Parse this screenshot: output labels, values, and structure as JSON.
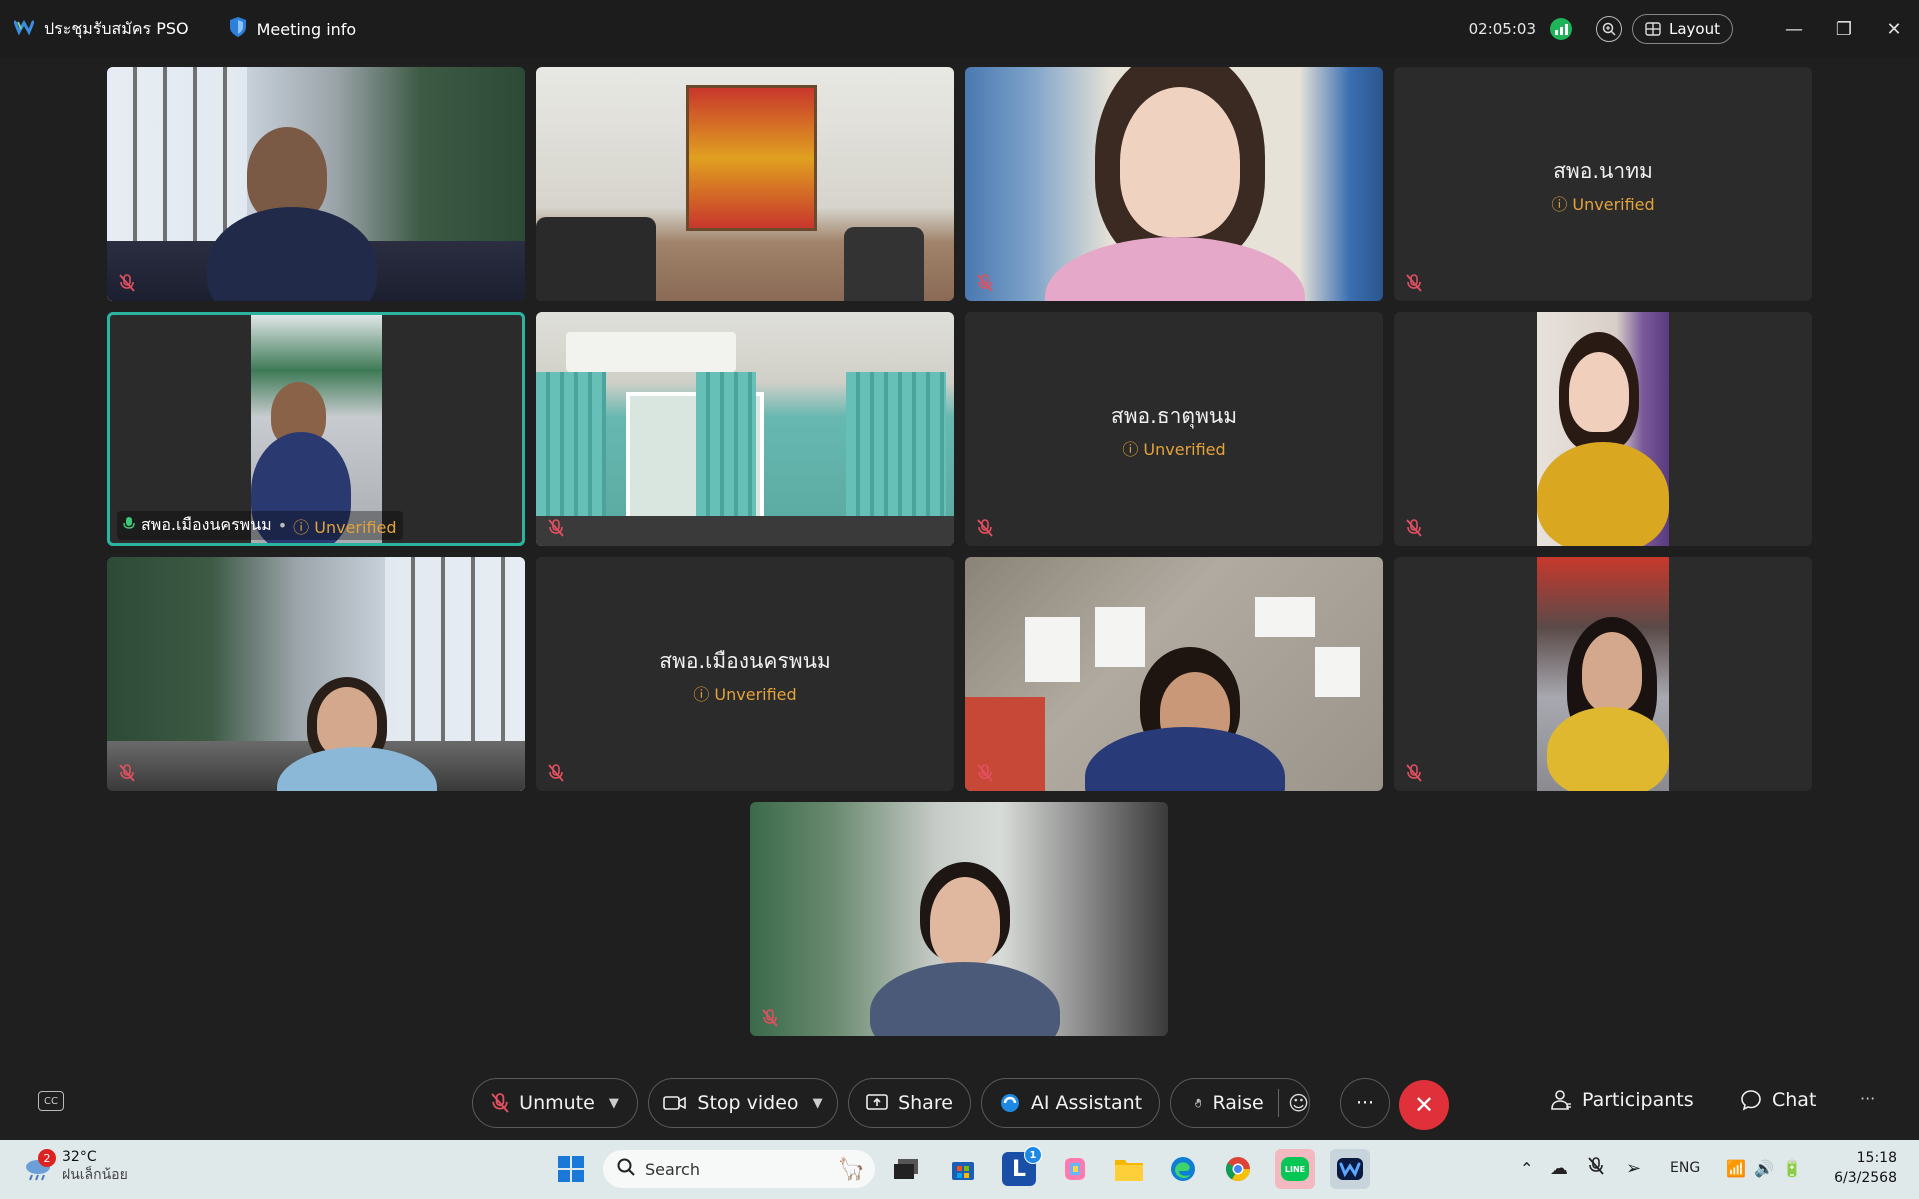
{
  "titlebar": {
    "meeting_name": "ประชุมรับสมัคร PSO",
    "meeting_info": "Meeting info",
    "timer": "02:05:03",
    "layout_label": "Layout"
  },
  "tiles": [
    {
      "type": "video",
      "muted": true
    },
    {
      "type": "video",
      "muted": false
    },
    {
      "type": "video",
      "muted": true
    },
    {
      "type": "name",
      "name": "สพอ.นาทม",
      "status": "Unverified",
      "muted": true
    },
    {
      "type": "video",
      "muted": false,
      "active": true,
      "name": "สพอ.เมืองนครพนม",
      "status": "Unverified"
    },
    {
      "type": "video",
      "muted": true
    },
    {
      "type": "name",
      "name": "สพอ.ธาตุพนม",
      "status": "Unverified",
      "muted": true
    },
    {
      "type": "video",
      "muted": true
    },
    {
      "type": "video",
      "muted": true
    },
    {
      "type": "name",
      "name": "สพอ.เมืองนครพนม",
      "status": "Unverified",
      "muted": true
    },
    {
      "type": "video",
      "muted": true
    },
    {
      "type": "video",
      "muted": true
    },
    {
      "type": "video",
      "muted": true
    }
  ],
  "controls": {
    "unmute": "Unmute",
    "stop_video": "Stop video",
    "share": "Share",
    "ai_assistant": "AI Assistant",
    "raise": "Raise",
    "more": "···",
    "participants": "Participants",
    "chat": "Chat",
    "overflow": "···"
  },
  "taskbar": {
    "weather_temp": "32°C",
    "weather_desc": "ฝนเล็กน้อย",
    "weather_badge": "2",
    "search_placeholder": "Search",
    "l_badge": "1",
    "language": "ENG",
    "time": "15:18",
    "date": "6/3/2568"
  }
}
